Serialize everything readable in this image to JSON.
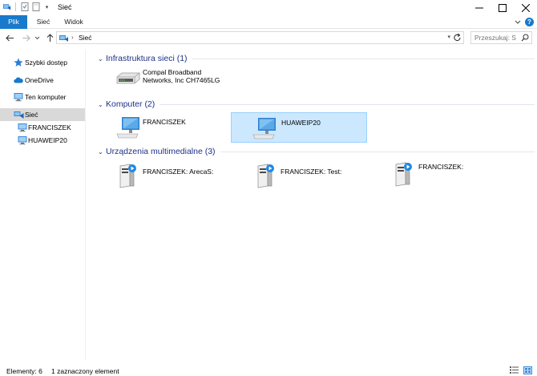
{
  "window": {
    "title": "Sieć"
  },
  "ribbon": {
    "tabs": [
      {
        "label": "Plik",
        "active": true
      },
      {
        "label": "Sieć",
        "active": false
      },
      {
        "label": "Widok",
        "active": false
      }
    ]
  },
  "address_bar": {
    "crumb": "Sieć",
    "search_placeholder": "Przeszukaj: S"
  },
  "sidebar": {
    "items": [
      {
        "label": "Szybki dostęp",
        "icon": "star-icon"
      },
      {
        "label": "OneDrive",
        "icon": "cloud-icon"
      },
      {
        "label": "Ten komputer",
        "icon": "computer-icon"
      },
      {
        "label": "Sieć",
        "icon": "network-icon",
        "selected": true
      },
      {
        "label": "FRANCISZEK",
        "icon": "computer-icon"
      },
      {
        "label": "HUAWEIP20",
        "icon": "computer-icon"
      }
    ]
  },
  "groups": [
    {
      "title": "Infrastruktura sieci (1)",
      "items": [
        {
          "label_line1": "Compal Broadband",
          "label_line2": "Networks, Inc CH7465LG",
          "icon": "router-icon"
        }
      ]
    },
    {
      "title": "Komputer (2)",
      "items": [
        {
          "label": "FRANCISZEK",
          "icon": "monitor-icon"
        },
        {
          "label": "HUAWEIP20",
          "icon": "monitor-icon",
          "selected": true
        }
      ]
    },
    {
      "title": "Urządzenia multimedialne (3)",
      "items": [
        {
          "label": "FRANCISZEK: ArecaS:",
          "icon": "media-device-icon"
        },
        {
          "label": "FRANCISZEK: Test:",
          "icon": "media-device-icon"
        },
        {
          "label": "FRANCISZEK:",
          "icon": "media-device-icon"
        }
      ]
    }
  ],
  "status_bar": {
    "items_count": "Elementy: 6",
    "selection": "1 zaznaczony element"
  },
  "colors": {
    "accent": "#1979ca",
    "selection_bg": "#cce8ff",
    "selection_border": "#99d1ff",
    "group_title": "#1e3287"
  }
}
